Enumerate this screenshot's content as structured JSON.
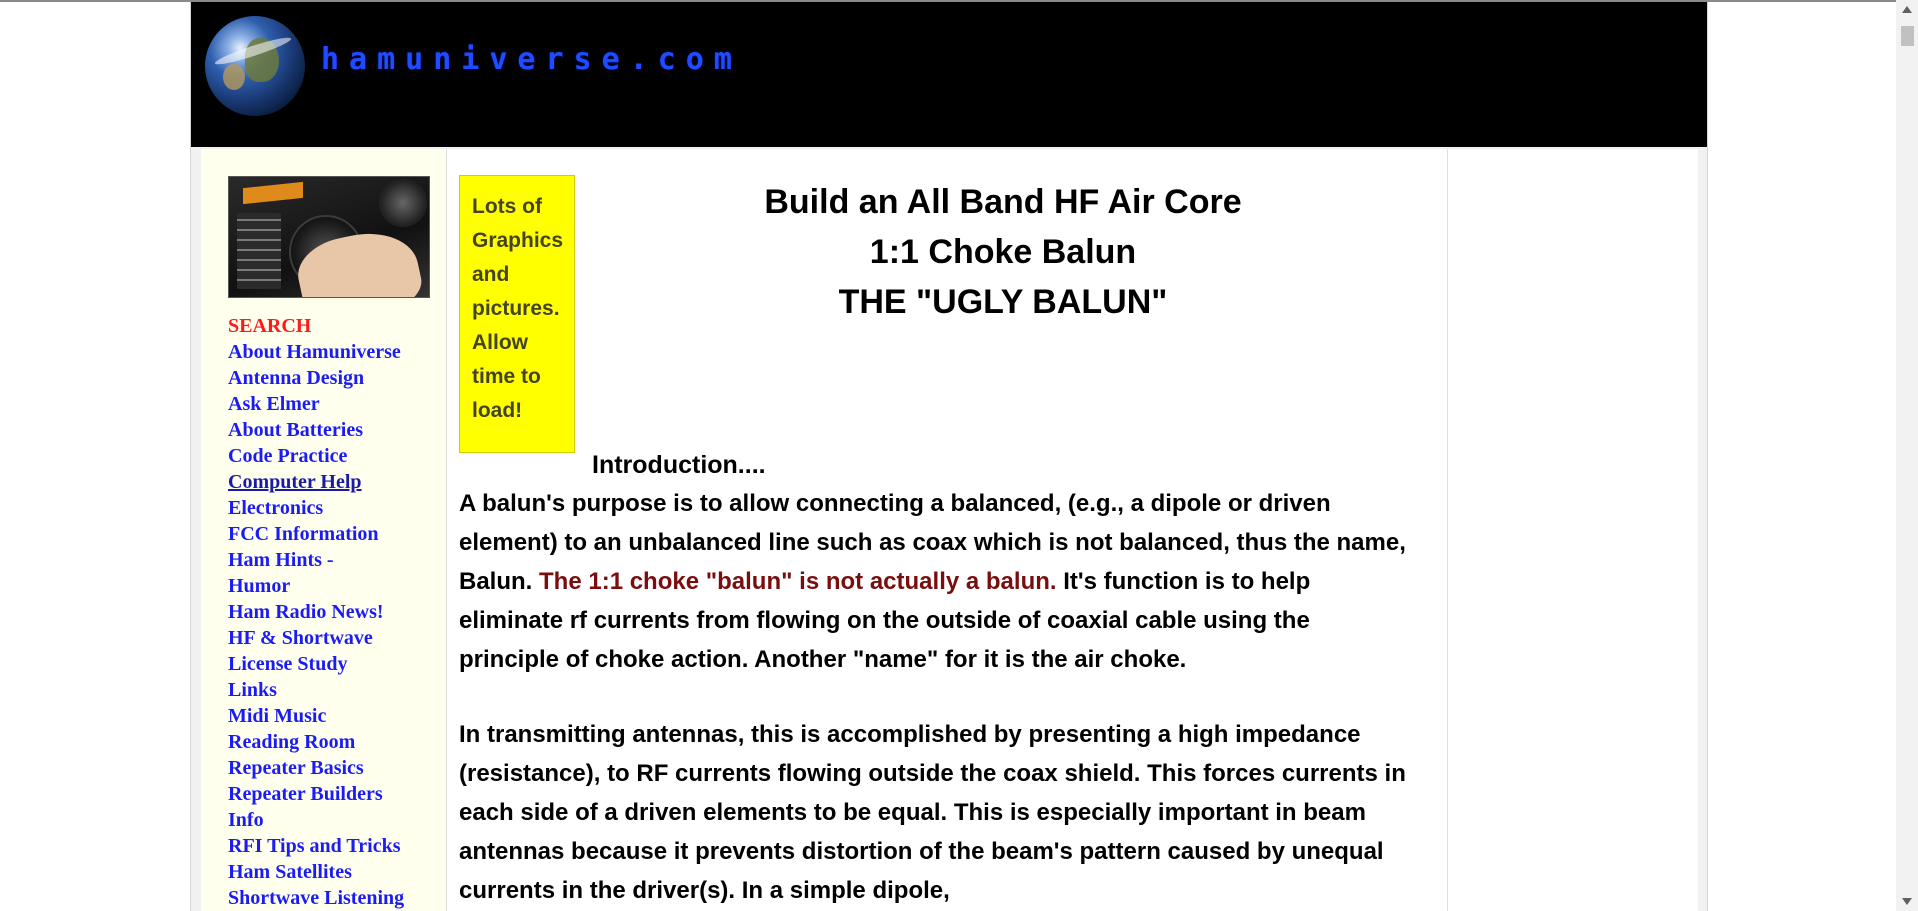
{
  "banner": {
    "site_title": "hamuniverse.com",
    "logo_icon": "globe-icon"
  },
  "sidebar": {
    "photo": "radio-dial-photo",
    "items": [
      {
        "label": "SEARCH"
      },
      {
        "label": "About Hamuniverse"
      },
      {
        "label": "Antenna Design"
      },
      {
        "label": "Ask Elmer"
      },
      {
        "label": "About Batteries"
      },
      {
        "label": "Code Practice"
      },
      {
        "label": "Computer Help"
      },
      {
        "label": "Electronics"
      },
      {
        "label": "FCC Information"
      },
      {
        "label": "Ham Hints -"
      },
      {
        "label": "Humor"
      },
      {
        "label": "Ham Radio News!"
      },
      {
        "label": "HF & Shortwave"
      },
      {
        "label": "License Study"
      },
      {
        "label": "Links"
      },
      {
        "label": "Midi Music"
      },
      {
        "label": "Reading Room"
      },
      {
        "label": "Repeater Basics"
      },
      {
        "label": "Repeater Builders"
      },
      {
        "label": "Info"
      },
      {
        "label": "RFI Tips and Tricks"
      },
      {
        "label": "Ham Satellites"
      },
      {
        "label": "Shortwave Listening"
      }
    ]
  },
  "main": {
    "notice": "Lots of Graphics and pictures. Allow time to load!",
    "title_line1": "Build an All Band HF Air Core",
    "title_line2": "1:1 Choke Balun",
    "title_line3": "THE \"UGLY BALUN\"",
    "intro_heading": "Introduction....",
    "para1_a": "A balun's purpose is to allow connecting a balanced, (e.g., a dipole or driven element) to an unbalanced line such as coax which is not balanced, thus the name, Balun. ",
    "para1_red": "The 1:1 choke \"balun\" is not actually a balun.",
    "para1_b": " It's function is to help eliminate rf currents from flowing on the outside of coaxial cable using the principle of choke action. Another \"name\" for it is the air choke.",
    "para2": "In transmitting antennas, this is accomplished by presenting a high impedance (resistance), to RF currents flowing outside the coax shield. This forces currents in each side of a driven elements to be equal. This is especially important in beam antennas because it prevents distortion of the beam's pattern caused by unequal currents in the driver(s). In a simple dipole,"
  },
  "colors": {
    "banner_bg": "#000000",
    "title_blue": "#1f4cff",
    "nav_link": "#1b1bf5",
    "search_red": "#ff1a1a",
    "notice_yellow": "#ffff00",
    "emphasis_red": "#7a0e0e",
    "sidebar_bg": "#ffffee"
  }
}
